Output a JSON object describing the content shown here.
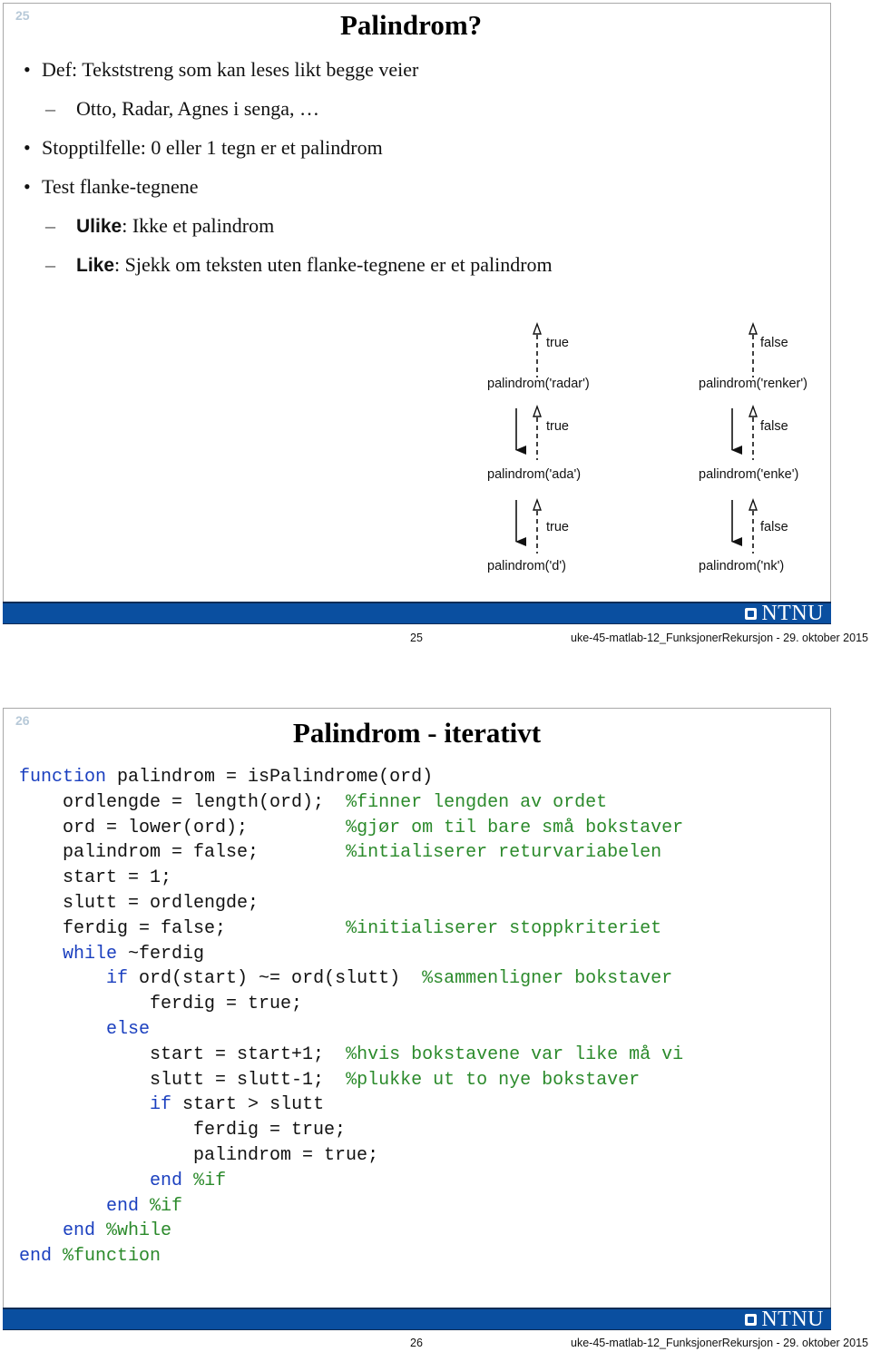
{
  "slides": [
    {
      "number": "25",
      "title": "Palindrom?",
      "bullets": [
        {
          "level": 1,
          "marker": "•",
          "text": "Def: Tekststreng som kan leses likt begge veier"
        },
        {
          "level": 2,
          "marker": "–",
          "text": "Otto, Radar, Agnes i senga, …"
        },
        {
          "level": 1,
          "marker": "•",
          "text": "Stopptilfelle: 0 eller 1 tegn er et palindrom"
        },
        {
          "level": 1,
          "marker": "•",
          "text": "Test flanke-tegnene"
        },
        {
          "level": 2,
          "marker": "–",
          "keyword": "Ulike",
          "text": ": Ikke et palindrom"
        },
        {
          "level": 2,
          "marker": "–",
          "keyword": "Like",
          "text": ": Sjekk om teksten uten flanke-tegnene er et palindrom"
        }
      ],
      "diagram": {
        "columns": [
          {
            "top_return": "true",
            "calls": [
              "palindrom('radar')",
              "palindrom('ada')",
              "palindrom('d')"
            ],
            "returns": [
              "true",
              "true"
            ]
          },
          {
            "top_return": "false",
            "calls": [
              "palindrom('renker')",
              "palindrom('enke')",
              "palindrom('nk')"
            ],
            "returns": [
              "false",
              "false"
            ]
          }
        ]
      },
      "footer": {
        "logo": "NTNU",
        "page": "25",
        "document": "uke-45-matlab-12_FunksjonerRekursjon - 29. oktober 2015"
      }
    },
    {
      "number": "26",
      "title": "Palindrom - iterativt",
      "code_lines": [
        [
          {
            "t": "function",
            "s": "k"
          },
          {
            "t": " palindrom = isPalindrome(ord)"
          }
        ],
        [
          {
            "t": "    ordlengde = length(ord);  "
          },
          {
            "t": "%finner lengden av ordet",
            "s": "c"
          }
        ],
        [
          {
            "t": "    ord = lower(ord);         "
          },
          {
            "t": "%gjør om til bare små bokstaver",
            "s": "c"
          }
        ],
        [
          {
            "t": "    palindrom = false;        "
          },
          {
            "t": "%intialiserer returvariabelen",
            "s": "c"
          }
        ],
        [
          {
            "t": "    start = 1;"
          }
        ],
        [
          {
            "t": "    slutt = ordlengde;"
          }
        ],
        [
          {
            "t": "    ferdig = false;           "
          },
          {
            "t": "%initialiserer stoppkriteriet",
            "s": "c"
          }
        ],
        [
          {
            "t": "    "
          },
          {
            "t": "while",
            "s": "k"
          },
          {
            "t": " ~ferdig"
          }
        ],
        [
          {
            "t": "        "
          },
          {
            "t": "if",
            "s": "k"
          },
          {
            "t": " ord(start) ~= ord(slutt)  "
          },
          {
            "t": "%sammenligner bokstaver",
            "s": "c"
          }
        ],
        [
          {
            "t": "            ferdig = true;"
          }
        ],
        [
          {
            "t": "        "
          },
          {
            "t": "else",
            "s": "k"
          }
        ],
        [
          {
            "t": "            start = start+1;  "
          },
          {
            "t": "%hvis bokstavene var like må vi",
            "s": "c"
          }
        ],
        [
          {
            "t": "            slutt = slutt-1;  "
          },
          {
            "t": "%plukke ut to nye bokstaver",
            "s": "c"
          }
        ],
        [
          {
            "t": "            "
          },
          {
            "t": "if",
            "s": "k"
          },
          {
            "t": " start > slutt"
          }
        ],
        [
          {
            "t": "                ferdig = true;"
          }
        ],
        [
          {
            "t": "                palindrom = true;"
          }
        ],
        [
          {
            "t": "            "
          },
          {
            "t": "end",
            "s": "k"
          },
          {
            "t": " "
          },
          {
            "t": "%if",
            "s": "c"
          }
        ],
        [
          {
            "t": "        "
          },
          {
            "t": "end",
            "s": "k"
          },
          {
            "t": " "
          },
          {
            "t": "%if",
            "s": "c"
          }
        ],
        [
          {
            "t": "    "
          },
          {
            "t": "end",
            "s": "k"
          },
          {
            "t": " "
          },
          {
            "t": "%while",
            "s": "c"
          }
        ],
        [
          {
            "t": "end",
            "s": "k"
          },
          {
            "t": " "
          },
          {
            "t": "%function",
            "s": "c"
          }
        ]
      ],
      "footer": {
        "logo": "NTNU",
        "page": "26",
        "document": "uke-45-matlab-12_FunksjonerRekursjon - 29. oktober 2015"
      }
    }
  ],
  "colors": {
    "ntnu_blue": "#0a4fa0",
    "keyword_blue": "#1a3fbf",
    "comment_green": "#2b8a2b",
    "slide_number": "#b7c9d8"
  }
}
